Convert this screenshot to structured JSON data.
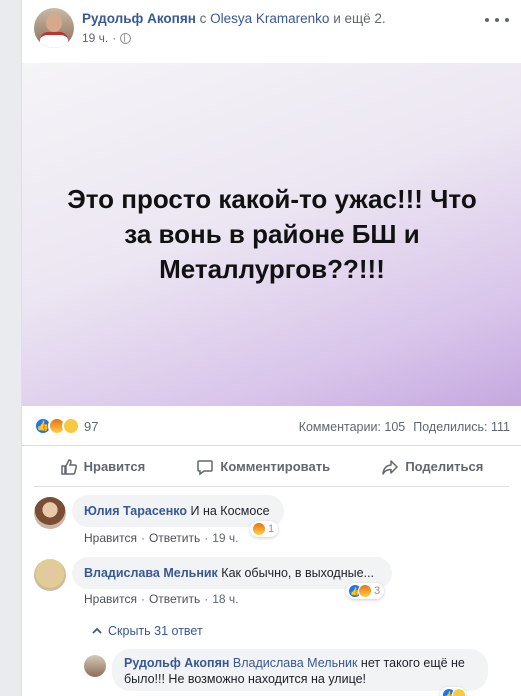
{
  "post": {
    "author": "Рудольф Акопян",
    "connector": "с",
    "tagged": "Olesya Kramarenko",
    "others": "и ещё 2.",
    "time": "19 ч.",
    "text": "Это просто какой-то ужас!!! Что за вонь в районе БШ и Металлургов??!!!",
    "bg_colors": [
      "#f5f4f7",
      "#ece6f2",
      "#d8c4ea",
      "#c4a8e0"
    ]
  },
  "stats": {
    "reactions_count": "97",
    "comments": "Комментарии: 105",
    "shares": "Поделились: 111"
  },
  "actions": {
    "like": "Нравится",
    "comment": "Комментировать",
    "share": "Поделиться"
  },
  "comments": [
    {
      "author": "Юлия Тарасенко",
      "text": "И на Космосе",
      "like_label": "Нравится",
      "reply_label": "Ответить",
      "time": "19 ч.",
      "reaction_count": "1"
    },
    {
      "author": "Владислава Мельник",
      "text": "Как обычно, в выходные...",
      "like_label": "Нравится",
      "reply_label": "Ответить",
      "time": "18 ч.",
      "reaction_count": "3"
    }
  ],
  "hide_replies": "Скрыть 31 ответ",
  "reply": {
    "author": "Рудольф Акопян",
    "mention": "Владислава Мельник",
    "text_line1": "нет такого ещё не",
    "text_line2": "было!!! Не возможно находится на улице!"
  },
  "separator": "·",
  "colors": {
    "link": "#385898",
    "like_blue": "#1877f2"
  }
}
